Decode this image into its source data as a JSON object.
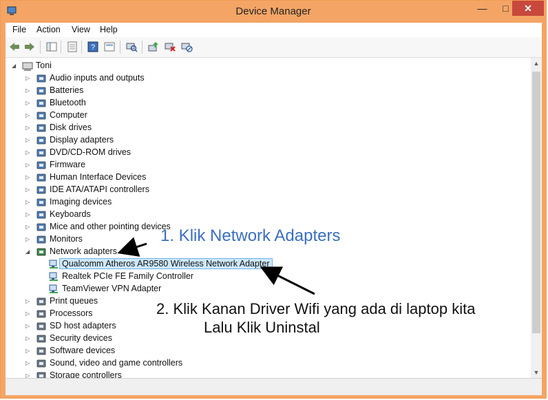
{
  "window": {
    "title": "Device Manager",
    "minimize": "—",
    "maximize": "□",
    "close": "✕"
  },
  "menu": [
    "File",
    "Action",
    "View",
    "Help"
  ],
  "toolbar": {
    "buttons": [
      "back-icon",
      "forward-icon",
      "show-hide-tree-icon",
      "properties-icon",
      "help-icon",
      "view-icon",
      "scan-hardware-icon",
      "update-driver-icon",
      "uninstall-device-icon",
      "disable-device-icon"
    ]
  },
  "tree": {
    "root": "Toni",
    "categories": [
      {
        "label": "Audio inputs and outputs",
        "icon": "speaker-icon"
      },
      {
        "label": "Batteries",
        "icon": "battery-icon"
      },
      {
        "label": "Bluetooth",
        "icon": "bluetooth-icon"
      },
      {
        "label": "Computer",
        "icon": "computer-icon"
      },
      {
        "label": "Disk drives",
        "icon": "disk-drive-icon"
      },
      {
        "label": "Display adapters",
        "icon": "display-adapter-icon"
      },
      {
        "label": "DVD/CD-ROM drives",
        "icon": "dvd-drive-icon"
      },
      {
        "label": "Firmware",
        "icon": "firmware-icon"
      },
      {
        "label": "Human Interface Devices",
        "icon": "hid-icon"
      },
      {
        "label": "IDE ATA/ATAPI controllers",
        "icon": "ide-controller-icon"
      },
      {
        "label": "Imaging devices",
        "icon": "camera-icon"
      },
      {
        "label": "Keyboards",
        "icon": "keyboard-icon"
      },
      {
        "label": "Mice and other pointing devices",
        "icon": "mouse-icon"
      },
      {
        "label": "Monitors",
        "icon": "monitor-icon"
      },
      {
        "label": "Network adapters",
        "icon": "network-adapter-icon",
        "expanded": true
      }
    ],
    "network_children": [
      {
        "label": "Qualcomm Atheros AR9580 Wireless Network Adapter",
        "selected": true
      },
      {
        "label": "Realtek PCIe FE Family Controller"
      },
      {
        "label": "TeamViewer VPN Adapter"
      }
    ],
    "categories_after": [
      {
        "label": "Print queues",
        "icon": "printer-icon"
      },
      {
        "label": "Processors",
        "icon": "processor-icon"
      },
      {
        "label": "SD host adapters",
        "icon": "sd-card-icon"
      },
      {
        "label": "Security devices",
        "icon": "security-device-icon"
      },
      {
        "label": "Software devices",
        "icon": "software-device-icon"
      },
      {
        "label": "Sound, video and game controllers",
        "icon": "sound-icon"
      },
      {
        "label": "Storage controllers",
        "icon": "storage-controller-icon"
      }
    ]
  },
  "annotations": {
    "step1": "1. Klik Network Adapters",
    "step2_line1": "2. Klik Kanan Driver Wifi yang ada di laptop kita",
    "step2_line2": "Lalu Klik Uninstal"
  },
  "colors": {
    "titlebar": "#f4a565",
    "close_button": "#c9483d",
    "selection": "#cde8fb",
    "annotation_blue": "#3a6fbf"
  }
}
